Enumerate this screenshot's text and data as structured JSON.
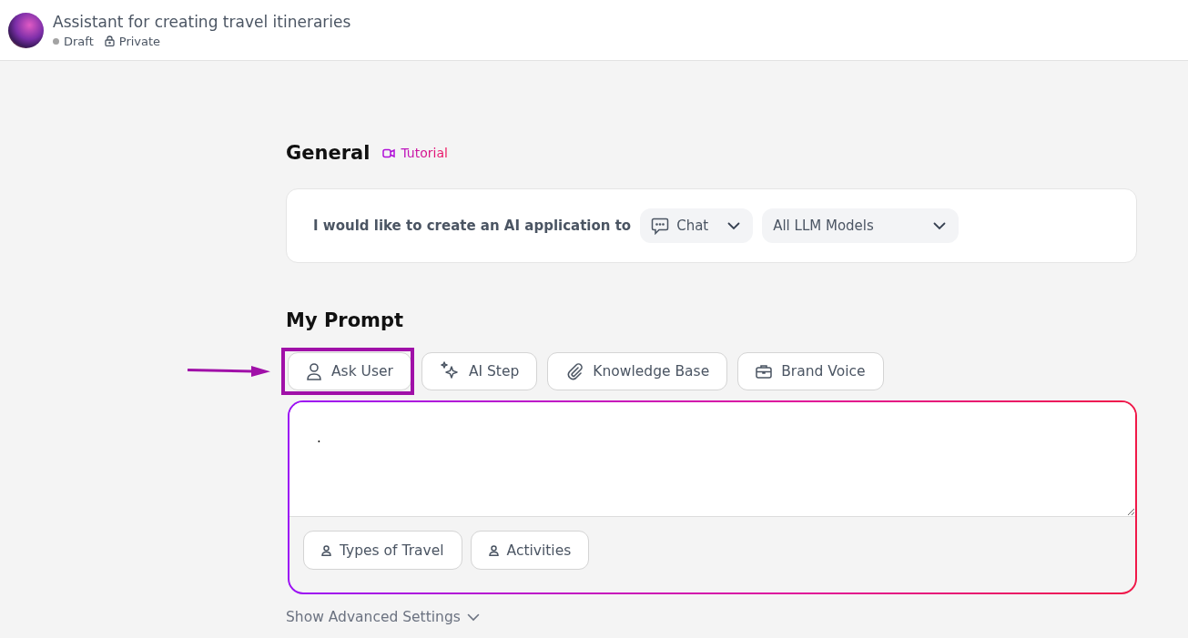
{
  "header": {
    "title": "Assistant for creating travel itineraries",
    "status": "Draft",
    "visibility": "Private"
  },
  "general": {
    "heading": "General",
    "tutorial_link": "Tutorial",
    "sentence": "I would like to create an AI application to",
    "app_type": "Chat",
    "model": "All LLM Models"
  },
  "prompt": {
    "heading": "My Prompt",
    "tools": [
      {
        "kind": "user",
        "label": "Ask User",
        "highlighted": true
      },
      {
        "kind": "sparkle",
        "label": "AI Step",
        "highlighted": false
      },
      {
        "kind": "clip",
        "label": "Knowledge Base",
        "highlighted": false
      },
      {
        "kind": "briefcase",
        "label": "Brand Voice",
        "highlighted": false
      }
    ],
    "value": ".",
    "variables": [
      "Types of Travel",
      "Activities"
    ]
  },
  "advanced_link": "Show Advanced Settings"
}
